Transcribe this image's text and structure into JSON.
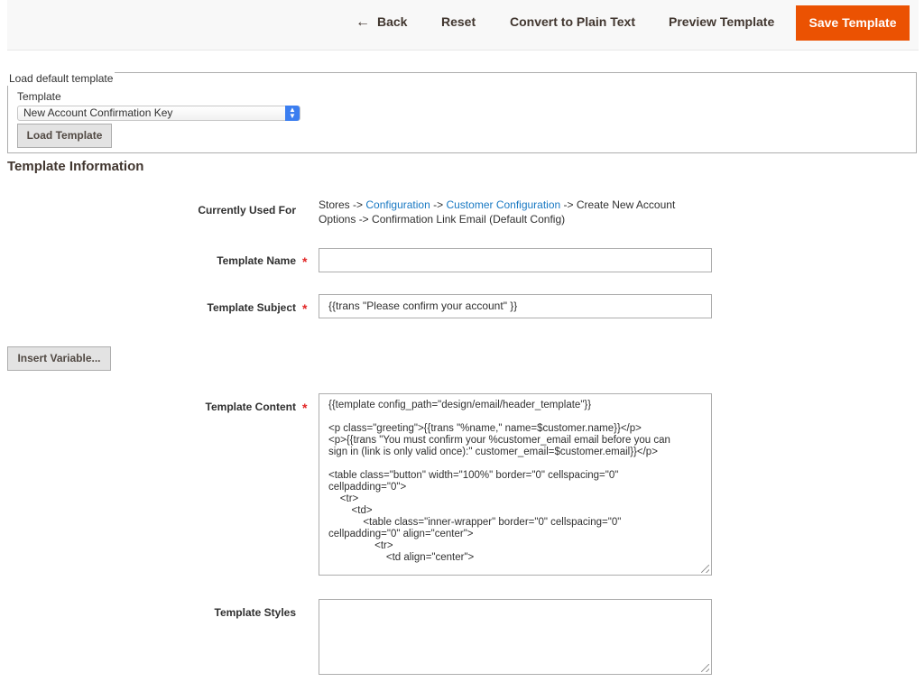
{
  "toolbar": {
    "back_icon": "←",
    "back_label": "Back",
    "reset_label": "Reset",
    "convert_label": "Convert to Plain Text",
    "preview_label": "Preview Template",
    "save_label": "Save Template",
    "accent_color": "#eb5202"
  },
  "load_default": {
    "legend": "Load default template",
    "template_label": "Template",
    "selected_template": "New Account Confirmation Key",
    "load_button": "Load Template"
  },
  "template_info": {
    "title": "Template Information",
    "used_for": {
      "label": "Currently Used For",
      "prefix": "Stores ->",
      "link1": "Configuration",
      "sep1": "->",
      "link2": "Customer Configuration",
      "suffix": "-> Create New Account Options -> Confirmation Link Email  (Default Config)",
      "link_color": "#1979c3"
    },
    "name": {
      "label": "Template Name",
      "required_mark": "*",
      "value": ""
    },
    "subject": {
      "label": "Template Subject",
      "required_mark": "*",
      "value": "{{trans  \"Please confirm your account\" }}"
    },
    "insert_variable": "Insert Variable...",
    "content": {
      "label": "Template Content",
      "required_mark": "*",
      "lines": [
        "{{template config_path=\"design/email/header_template\"}}",
        "",
        "<p class=\"greeting\">{{trans \"%name,\" name=$customer.name}}</p>",
        "<p>{{trans \"You must confirm your %customer_email email before you can",
        "sign in (link is only valid once):\" customer_email=$customer.email}}</p>",
        "",
        "<table class=\"button\" width=\"100%\" border=\"0\" cellspacing=\"0\"",
        "cellpadding=\"0\">",
        "    <tr>",
        "        <td>",
        "            <table class=\"inner-wrapper\" border=\"0\" cellspacing=\"0\"",
        "cellpadding=\"0\" align=\"center\">",
        "                <tr>",
        "                    <td align=\"center\">"
      ]
    },
    "styles": {
      "label": "Template Styles",
      "value": ""
    }
  }
}
